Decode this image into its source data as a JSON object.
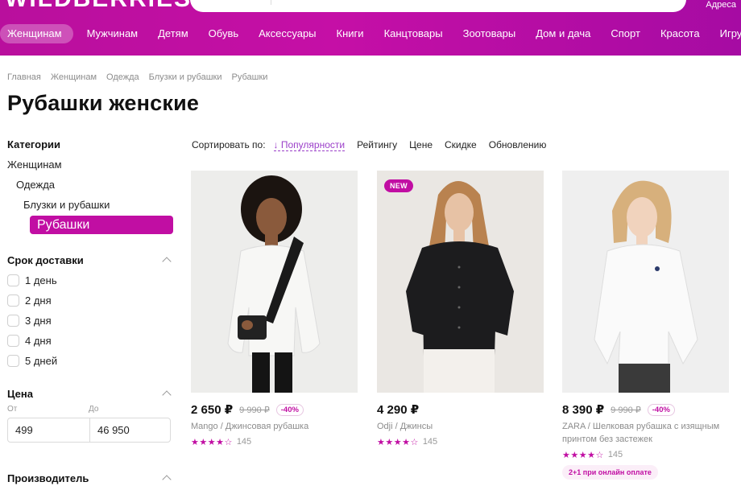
{
  "header": {
    "logo": "WILDBERRIES",
    "address_link": "Адреса",
    "nav": [
      {
        "label": "Женщинам",
        "active": true
      },
      {
        "label": "Мужчинам"
      },
      {
        "label": "Детям"
      },
      {
        "label": "Обувь"
      },
      {
        "label": "Аксессуары"
      },
      {
        "label": "Книги"
      },
      {
        "label": "Канцтовары"
      },
      {
        "label": "Зоотовары"
      },
      {
        "label": "Дом и дача"
      },
      {
        "label": "Спорт"
      },
      {
        "label": "Красота"
      },
      {
        "label": "Игру"
      }
    ]
  },
  "breadcrumb": [
    "Главная",
    "Женщинам",
    "Одежда",
    "Блузки и рубашки",
    "Рубашки"
  ],
  "page_title": "Рубашки женские",
  "sidebar": {
    "categories_heading": "Категории",
    "categories": [
      {
        "label": "Женщинам",
        "level": 0
      },
      {
        "label": "Одежда",
        "level": 1
      },
      {
        "label": "Блузки и рубашки",
        "level": 2
      },
      {
        "label": "Рубашки",
        "level": 3,
        "active": true
      }
    ],
    "delivery_heading": "Срок доставки",
    "delivery_options": [
      "1 день",
      "2 дня",
      "3 дня",
      "4 дня",
      "5 дней"
    ],
    "price_heading": "Цена",
    "price_from_label": "От",
    "price_to_label": "До",
    "price_from": "499",
    "price_to": "46 950",
    "maker_heading": "Производитель"
  },
  "sort": {
    "label": "Сортировать по:",
    "options": [
      {
        "label": "↓ Популярности",
        "active": true
      },
      {
        "label": "Рейтингу"
      },
      {
        "label": "Цене"
      },
      {
        "label": "Скидке"
      },
      {
        "label": "Обновлению"
      }
    ]
  },
  "products": [
    {
      "price": "2 650 ₽",
      "old_price": "9 990 ₽",
      "discount": "-40%",
      "title": "Mango / Джинсовая рубашка",
      "rating": 4,
      "reviews": "145",
      "badge": "",
      "promo": ""
    },
    {
      "price": "4 290 ₽",
      "old_price": "",
      "discount": "",
      "title": "Odji / Джинсы",
      "rating": 4,
      "reviews": "145",
      "badge": "NEW",
      "promo": ""
    },
    {
      "price": "8 390 ₽",
      "old_price": "9 990 ₽",
      "discount": "-40%",
      "title": "ZARA / Шелковая рубашка с изящным принтом без застежек",
      "rating": 4,
      "reviews": "145",
      "badge": "",
      "promo": "2+1 при онлайн оплате"
    }
  ],
  "colors": {
    "brand": "#c10ea3",
    "header_gradient_start": "#b90f9d",
    "header_gradient_end": "#a60ba3"
  }
}
